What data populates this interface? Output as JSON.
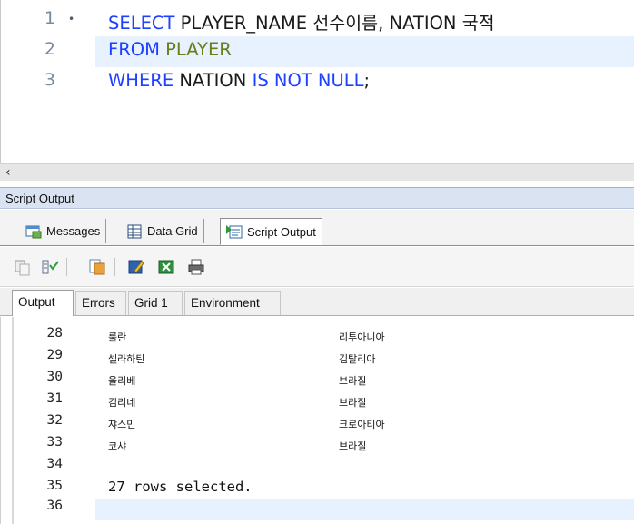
{
  "editor": {
    "lines": [
      {
        "number": "1",
        "fold": "•",
        "parts": [
          {
            "text": "SELECT",
            "kind": "kw"
          },
          {
            "text": " PLAYER_NAME 선수이름",
            "kind": "id"
          },
          {
            "text": ", ",
            "kind": "id"
          },
          {
            "text": "NATION",
            "kind": "id"
          },
          {
            "text": " 국적",
            "kind": "id"
          }
        ]
      },
      {
        "number": "2",
        "parts": [
          {
            "text": "FROM",
            "kind": "kw"
          },
          {
            "text": " PLAYER",
            "kind": "ob"
          }
        ]
      },
      {
        "number": "3",
        "parts": [
          {
            "text": "WHERE",
            "kind": "kw"
          },
          {
            "text": " NATION ",
            "kind": "id"
          },
          {
            "text": "IS NOT NULL",
            "kind": "kw"
          },
          {
            "text": ";",
            "kind": "id"
          }
        ]
      }
    ],
    "scroll_left_glyph": "‹"
  },
  "panel": {
    "title": "Script Output",
    "tabs": [
      {
        "label": "Messages",
        "icon": "messages-icon"
      },
      {
        "label": "Data Grid",
        "icon": "data-grid-icon"
      },
      {
        "label": "Script Output",
        "icon": "script-output-icon",
        "active": true
      }
    ],
    "toolbar_icons": [
      "copy-icon",
      "filter-icon",
      "clear-icon",
      "edit-icon",
      "export-excel-icon",
      "print-icon"
    ],
    "output_tabs": [
      {
        "label": "Output",
        "active": true
      },
      {
        "label": "Errors"
      },
      {
        "label": "Grid 1"
      },
      {
        "label": "Environment"
      }
    ]
  },
  "output": {
    "rows": [
      {
        "line": "28",
        "name": "룰란",
        "nation": "리투아니아"
      },
      {
        "line": "29",
        "name": "셀라하틴",
        "nation": "김탈리아"
      },
      {
        "line": "30",
        "name": "울리베",
        "nation": "브라질"
      },
      {
        "line": "31",
        "name": "김리네",
        "nation": "브라질"
      },
      {
        "line": "32",
        "name": "쟈스민",
        "nation": "크로아티아"
      },
      {
        "line": "33",
        "name": "코샤",
        "nation": "브라질"
      },
      {
        "line": "34",
        "name": "",
        "nation": ""
      }
    ],
    "message_line": "35",
    "message": "27 rows selected.",
    "last_line": "36"
  },
  "colors": {
    "keyword": "#1e40ff",
    "object": "#6b7d1b",
    "current_line": "#e8f2fe",
    "panel_header": "#d9e3f2"
  }
}
